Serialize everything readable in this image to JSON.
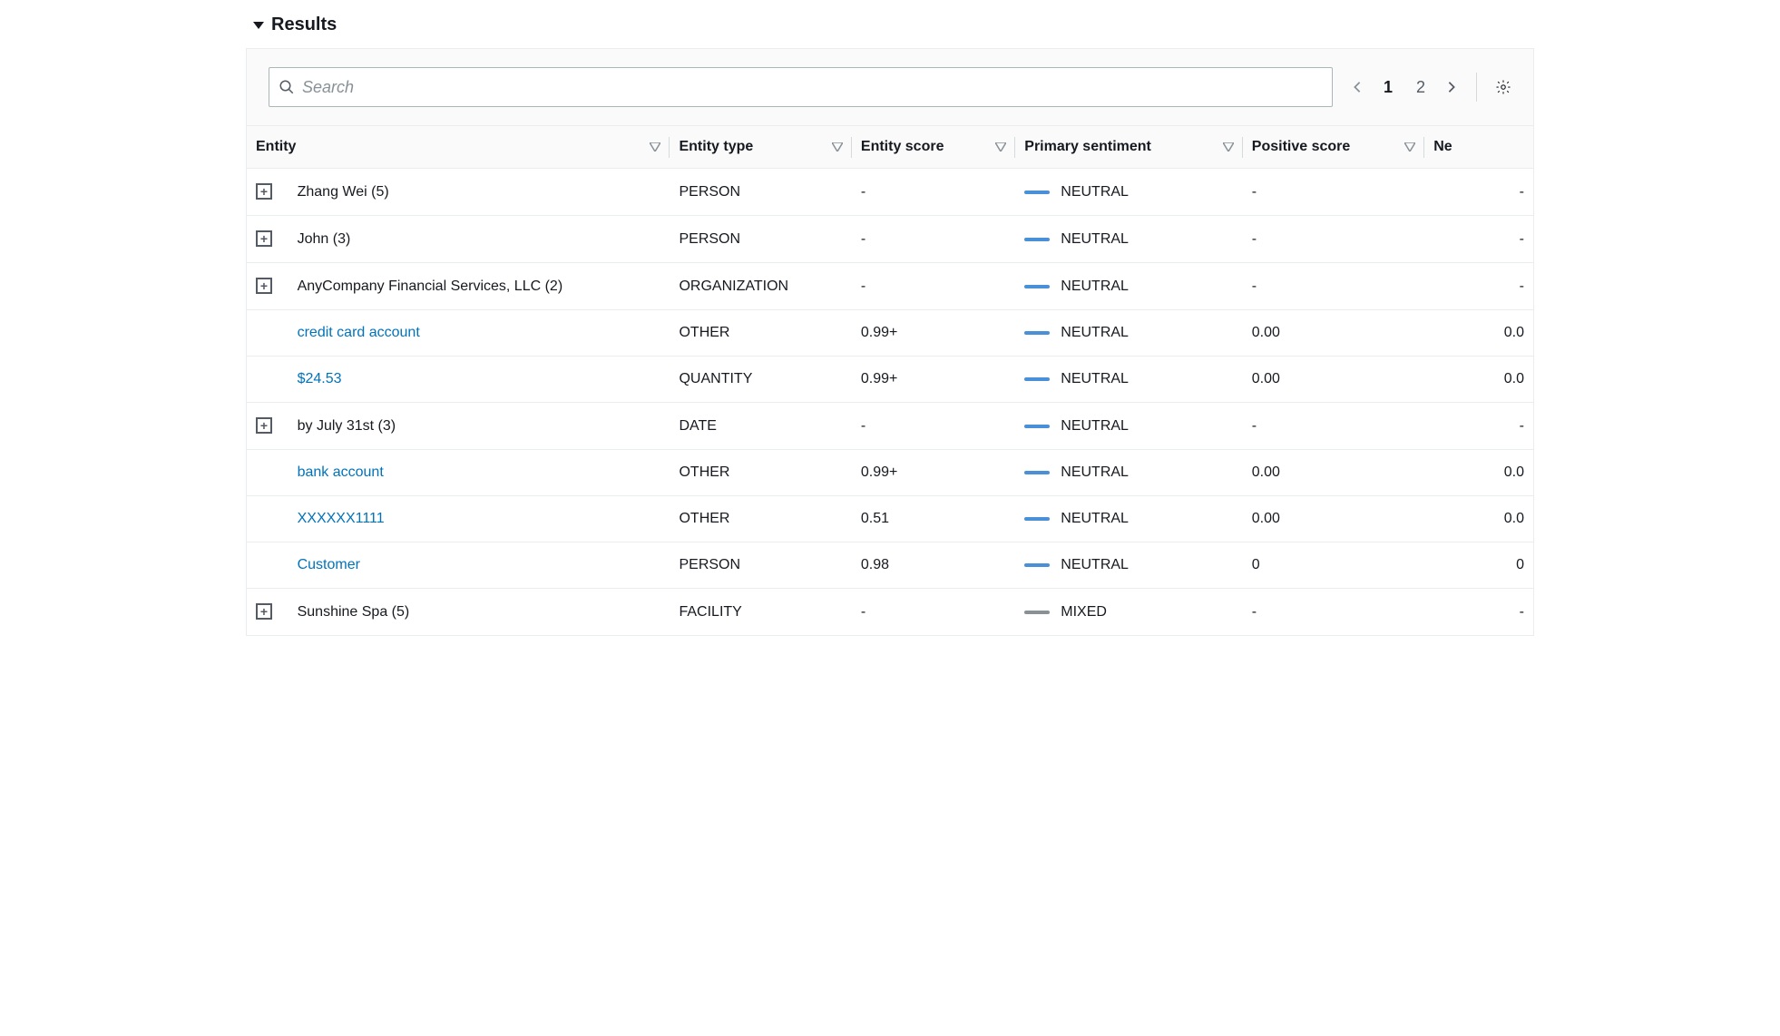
{
  "panel": {
    "title": "Results"
  },
  "search": {
    "placeholder": "Search"
  },
  "pagination": {
    "current": "1",
    "other": "2"
  },
  "columns": {
    "entity": "Entity",
    "type": "Entity type",
    "score": "Entity score",
    "sentiment": "Primary sentiment",
    "positive": "Positive score",
    "negative": "Ne"
  },
  "sentiments": {
    "neutral": "NEUTRAL",
    "mixed": "MIXED"
  },
  "rows": [
    {
      "expandable": true,
      "link": false,
      "entity": "Zhang Wei (5)",
      "type": "PERSON",
      "score": "-",
      "sentiment": "neutral",
      "positive": "-",
      "negative": "-"
    },
    {
      "expandable": true,
      "link": false,
      "entity": "John (3)",
      "type": "PERSON",
      "score": "-",
      "sentiment": "neutral",
      "positive": "-",
      "negative": "-"
    },
    {
      "expandable": true,
      "link": false,
      "entity": "AnyCompany Financial Services, LLC (2)",
      "type": "ORGANIZATION",
      "score": "-",
      "sentiment": "neutral",
      "positive": "-",
      "negative": "-"
    },
    {
      "expandable": false,
      "link": true,
      "entity": "credit card account",
      "type": "OTHER",
      "score": "0.99+",
      "sentiment": "neutral",
      "positive": "0.00",
      "negative": "0.0"
    },
    {
      "expandable": false,
      "link": true,
      "entity": "$24.53",
      "type": "QUANTITY",
      "score": "0.99+",
      "sentiment": "neutral",
      "positive": "0.00",
      "negative": "0.0"
    },
    {
      "expandable": true,
      "link": false,
      "entity": "by July 31st (3)",
      "type": "DATE",
      "score": "-",
      "sentiment": "neutral",
      "positive": "-",
      "negative": "-"
    },
    {
      "expandable": false,
      "link": true,
      "entity": "bank account",
      "type": "OTHER",
      "score": "0.99+",
      "sentiment": "neutral",
      "positive": "0.00",
      "negative": "0.0"
    },
    {
      "expandable": false,
      "link": true,
      "entity": "XXXXXX1111",
      "type": "OTHER",
      "score": "0.51",
      "sentiment": "neutral",
      "positive": "0.00",
      "negative": "0.0"
    },
    {
      "expandable": false,
      "link": true,
      "entity": "Customer",
      "type": "PERSON",
      "score": "0.98",
      "sentiment": "neutral",
      "positive": "0",
      "negative": "0"
    },
    {
      "expandable": true,
      "link": false,
      "entity": "Sunshine Spa (5)",
      "type": "FACILITY",
      "score": "-",
      "sentiment": "mixed",
      "positive": "-",
      "negative": "-"
    }
  ]
}
